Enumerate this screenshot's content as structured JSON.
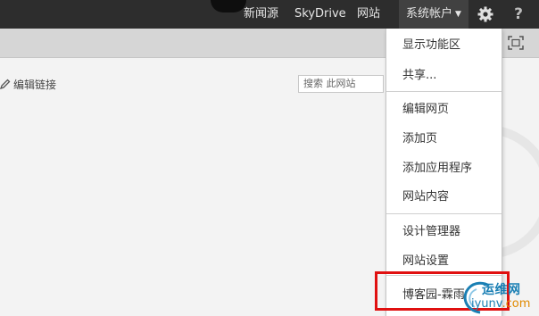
{
  "suite_bar": {
    "newsfeed": "新闻源",
    "skydrive": "SkyDrive",
    "sites": "网站",
    "account": "系统帐户",
    "help": "?"
  },
  "page": {
    "edit_links": "编辑链接",
    "search_placeholder": "搜索 此网站"
  },
  "menu": {
    "items": [
      "显示功能区",
      "共享...",
      "编辑网页",
      "添加页",
      "添加应用程序",
      "网站内容",
      "设计管理器",
      "网站设置",
      "博客园-霖雨"
    ]
  },
  "watermark": {
    "line1": "运维网",
    "line2_a": "iyunv",
    "line2_b": ".com"
  },
  "colors": {
    "suite_bar": "#2d2d2d",
    "highlight": "#e01010",
    "watermark": "#1a7fb4"
  }
}
